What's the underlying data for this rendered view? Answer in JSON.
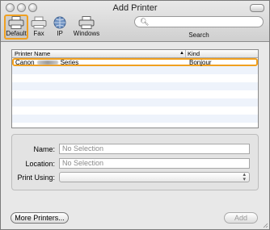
{
  "window": {
    "title": "Add Printer"
  },
  "toolbar": {
    "buttons": [
      {
        "label": "Default",
        "icon": "printer-default-icon"
      },
      {
        "label": "Fax",
        "icon": "fax-icon"
      },
      {
        "label": "IP",
        "icon": "globe-icon"
      },
      {
        "label": "Windows",
        "icon": "windows-printer-icon"
      }
    ],
    "search_label": "Search",
    "search_value": ""
  },
  "printer_list": {
    "columns": [
      "Printer Name",
      "Kind"
    ],
    "sort_indicator": "▲",
    "rows": [
      {
        "name_prefix": "Canon",
        "name_suffix": "Series",
        "kind": "Bonjour"
      }
    ]
  },
  "form": {
    "name_label": "Name:",
    "name_value": "No Selection",
    "location_label": "Location:",
    "location_value": "No Selection",
    "print_using_label": "Print Using:",
    "print_using_value": ""
  },
  "buttons": {
    "more_printers": "More Printers...",
    "add": "Add"
  },
  "colors": {
    "highlight": "#f0a020",
    "stripe": "#eef3fb"
  }
}
